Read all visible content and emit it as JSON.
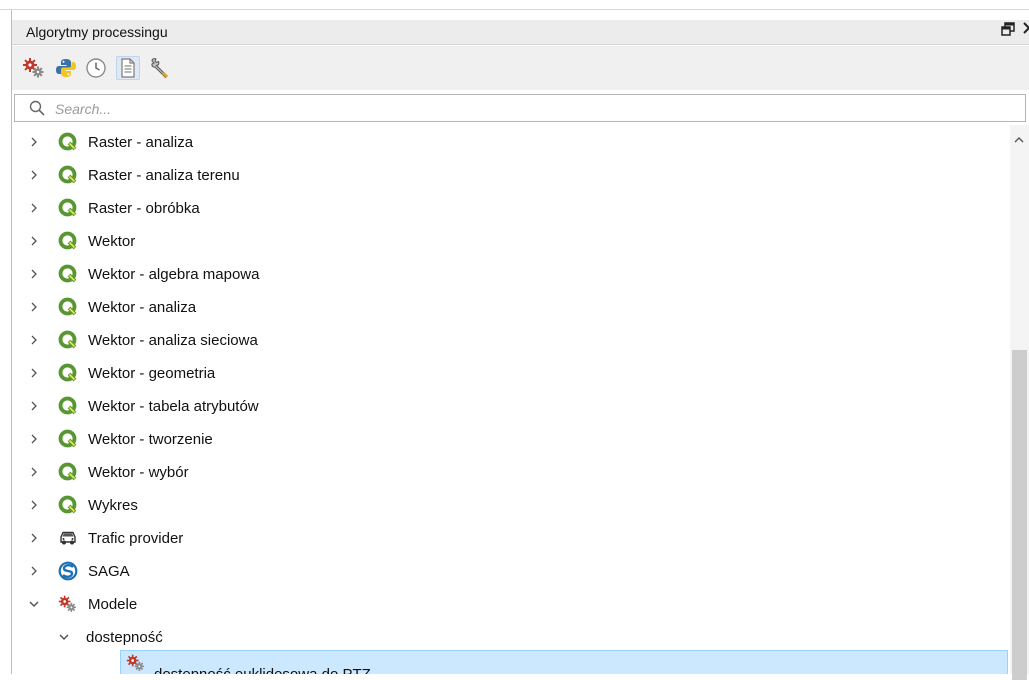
{
  "panel": {
    "title": "Algorytmy processingu"
  },
  "search": {
    "placeholder": "Search..."
  },
  "toolbar": {
    "buttons": [
      "models-icon",
      "python-icon",
      "history-icon",
      "results-icon",
      "options-icon"
    ]
  },
  "tree": {
    "items": [
      {
        "label": "Raster - analiza",
        "icon": "qgis-icon"
      },
      {
        "label": "Raster - analiza terenu",
        "icon": "qgis-icon"
      },
      {
        "label": "Raster - obróbka",
        "icon": "qgis-icon"
      },
      {
        "label": "Wektor",
        "icon": "qgis-icon"
      },
      {
        "label": "Wektor - algebra mapowa",
        "icon": "qgis-icon"
      },
      {
        "label": "Wektor - analiza",
        "icon": "qgis-icon"
      },
      {
        "label": "Wektor - analiza sieciowa",
        "icon": "qgis-icon"
      },
      {
        "label": "Wektor - geometria",
        "icon": "qgis-icon"
      },
      {
        "label": "Wektor - tabela atrybutów",
        "icon": "qgis-icon"
      },
      {
        "label": "Wektor - tworzenie",
        "icon": "qgis-icon"
      },
      {
        "label": "Wektor - wybór",
        "icon": "qgis-icon"
      },
      {
        "label": "Wykres",
        "icon": "qgis-icon"
      },
      {
        "label": "Trafic provider",
        "icon": "car-icon"
      },
      {
        "label": "SAGA",
        "icon": "saga-icon"
      },
      {
        "label": "Modele",
        "icon": "models-icon",
        "expanded": true
      },
      {
        "label": "dostepność",
        "expanded": true
      },
      {
        "label": "dostepność euklidesowa do PTZ",
        "icon": "models-icon",
        "selected": true
      }
    ]
  },
  "colors": {
    "qgis_green": "#589632",
    "qgis_yellow": "#f0e64a",
    "selection": "#cce8ff",
    "saga_blue": "#1b6fb5"
  }
}
